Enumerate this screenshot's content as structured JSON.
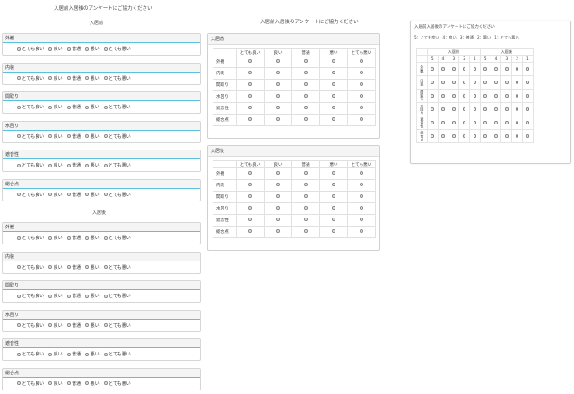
{
  "left": {
    "title": "入居前入居後のアンケートにご協力ください",
    "section_before": "入居前",
    "section_after": "入居後",
    "items": [
      "外観",
      "内装",
      "間取り",
      "水回り",
      "遮音性",
      "総合点"
    ],
    "options": [
      "とても良い",
      "良い",
      "普通",
      "悪い",
      "とても悪い"
    ]
  },
  "middle": {
    "title": "入居前入居後のアンケートにご協力ください",
    "panel_before": "入居前",
    "panel_after": "入居後",
    "columns": [
      "とても良い",
      "良い",
      "普通",
      "悪い",
      "とても悪い"
    ],
    "rows": [
      "外観",
      "内装",
      "間取り",
      "水回り",
      "遮音性",
      "総合点"
    ]
  },
  "right": {
    "title": "入居前入居後のアンケートにご協力ください",
    "legend": [
      "5：とても良い",
      "4：良い",
      "3：普通",
      "2：悪い",
      "1：とても悪い"
    ],
    "group_before": "入居前",
    "group_after": "入居後",
    "scale": [
      "5",
      "4",
      "3",
      "2",
      "1"
    ],
    "rows": [
      "外観",
      "内装",
      "間取り",
      "水回り",
      "遮音性",
      "総合点"
    ]
  },
  "colors": {
    "accent": "#5bc0de",
    "border": "#d6d6d6"
  }
}
